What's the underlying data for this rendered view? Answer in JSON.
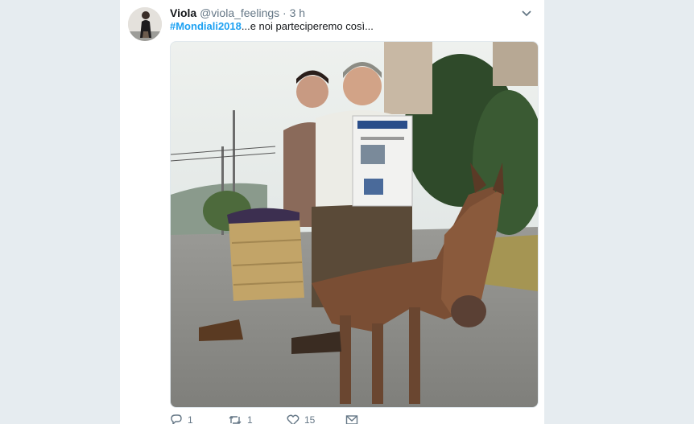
{
  "tweet": {
    "name": "Viola",
    "handle": "@viola_feelings",
    "separator": "·",
    "time": "3 h",
    "hashtag": "#Mondiali2018",
    "text": "...e noi parteciperemo così..."
  },
  "actions": {
    "reply_count": "1",
    "retweet_count": "1",
    "like_count": "15"
  },
  "icons": [
    "avatar",
    "chevron-down-icon",
    "reply-icon",
    "retweet-icon",
    "like-icon",
    "message-icon"
  ]
}
